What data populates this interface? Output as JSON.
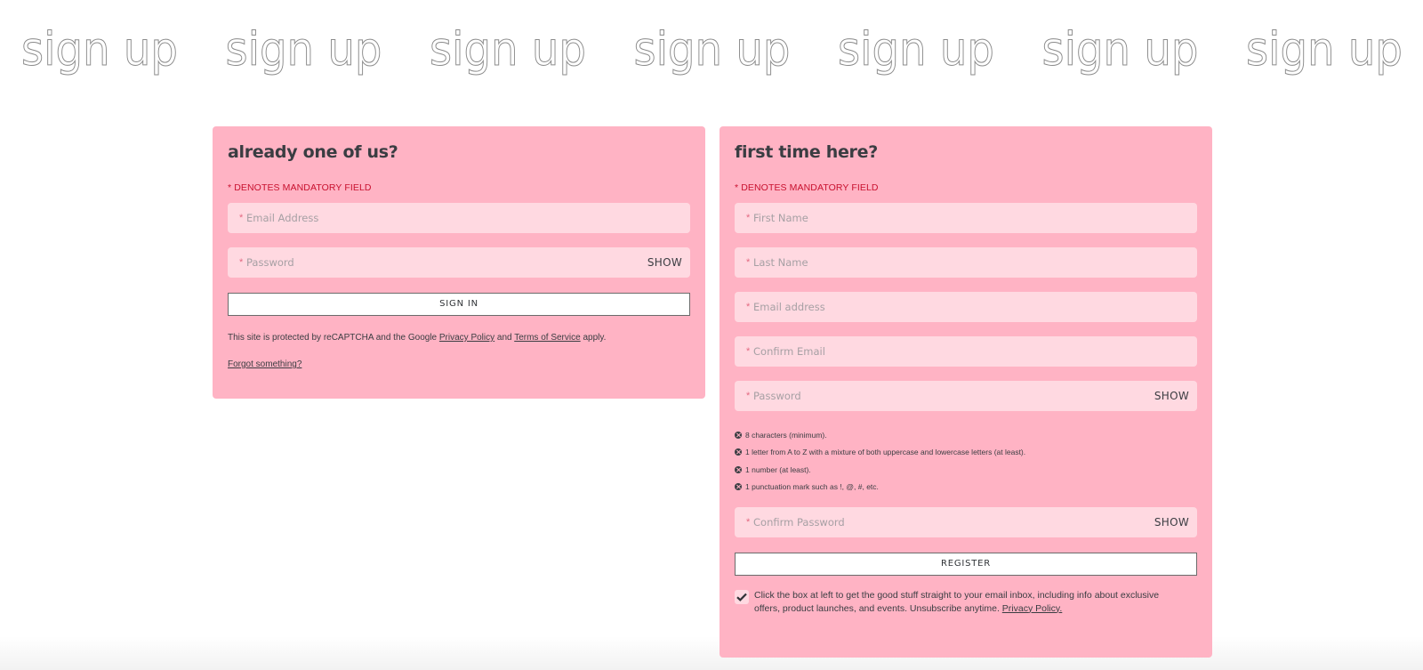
{
  "banner": {
    "text": "sign up",
    "repeat_count": 7
  },
  "signin": {
    "title": "already one of us?",
    "mandatory_note": "* DENOTES MANDATORY FIELD",
    "fields": {
      "email": {
        "placeholder": "Email Address",
        "value": ""
      },
      "password": {
        "placeholder": "Password",
        "value": "",
        "toggle_label": "SHOW"
      }
    },
    "submit_label": "SIGN IN",
    "legal": {
      "prefix": "This site is protected by reCAPTCHA and the Google ",
      "privacy_link": "Privacy Policy",
      "middle": " and ",
      "terms_link": "Terms of Service",
      "suffix": " apply."
    },
    "forgot_link": "Forgot something?"
  },
  "register": {
    "title": "first time here?",
    "mandatory_note": "* DENOTES MANDATORY FIELD",
    "fields": {
      "first_name": {
        "placeholder": "First Name",
        "value": ""
      },
      "last_name": {
        "placeholder": "Last Name",
        "value": ""
      },
      "email": {
        "placeholder": "Email address",
        "value": ""
      },
      "confirm_email": {
        "placeholder": "Confirm Email",
        "value": ""
      },
      "password": {
        "placeholder": "Password",
        "value": "",
        "toggle_label": "SHOW"
      },
      "confirm_password": {
        "placeholder": "Confirm Password",
        "value": "",
        "toggle_label": "SHOW"
      }
    },
    "password_rules": [
      "8 characters (minimum).",
      "1 letter from A to Z with a mixture of both uppercase and lowercase letters (at least).",
      "1 number (at least).",
      "1 punctuation mark such as !, @, #, etc."
    ],
    "submit_label": "REGISTER",
    "optin": {
      "checked": true,
      "text": "Click the box at left to get the good stuff straight to your email inbox, including info about exclusive offers, product launches, and events. Unsubscribe anytime. ",
      "privacy_link": "Privacy Policy."
    }
  },
  "colors": {
    "card_bg": "#ffb3c4",
    "field_bg": "#ffd9e1",
    "mandatory_red": "#c8102e",
    "text_dark": "#3a3d42"
  }
}
